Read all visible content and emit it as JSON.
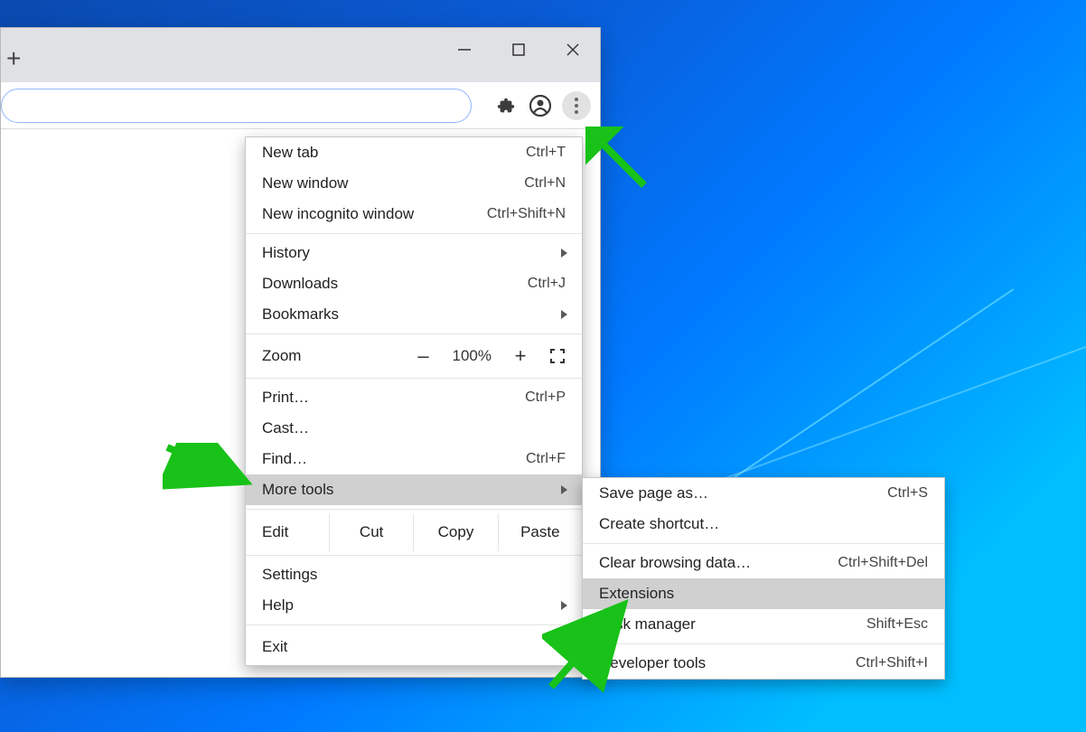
{
  "window": {
    "minimize_tooltip": "Minimize",
    "maximize_tooltip": "Maximize",
    "close_tooltip": "Close"
  },
  "toolbar": {
    "extensions_tooltip": "Extensions",
    "profile_tooltip": "You",
    "menu_tooltip": "Customize and control Google Chrome"
  },
  "menu": {
    "new_tab": {
      "label": "New tab",
      "shortcut": "Ctrl+T"
    },
    "new_window": {
      "label": "New window",
      "shortcut": "Ctrl+N"
    },
    "new_incognito": {
      "label": "New incognito window",
      "shortcut": "Ctrl+Shift+N"
    },
    "history": {
      "label": "History"
    },
    "downloads": {
      "label": "Downloads",
      "shortcut": "Ctrl+J"
    },
    "bookmarks": {
      "label": "Bookmarks"
    },
    "zoom": {
      "label": "Zoom",
      "value": "100%",
      "minus": "–",
      "plus": "+"
    },
    "print": {
      "label": "Print…",
      "shortcut": "Ctrl+P"
    },
    "cast": {
      "label": "Cast…"
    },
    "find": {
      "label": "Find…",
      "shortcut": "Ctrl+F"
    },
    "more_tools": {
      "label": "More tools"
    },
    "edit": {
      "label": "Edit",
      "cut": "Cut",
      "copy": "Copy",
      "paste": "Paste"
    },
    "settings": {
      "label": "Settings"
    },
    "help": {
      "label": "Help"
    },
    "exit": {
      "label": "Exit"
    }
  },
  "submenu": {
    "save_page": {
      "label": "Save page as…",
      "shortcut": "Ctrl+S"
    },
    "create_shortcut": {
      "label": "Create shortcut…"
    },
    "clear_data": {
      "label": "Clear browsing data…",
      "shortcut": "Ctrl+Shift+Del"
    },
    "extensions": {
      "label": "Extensions"
    },
    "task_manager": {
      "label": "Task manager",
      "shortcut": "Shift+Esc"
    },
    "dev_tools": {
      "label": "Developer tools",
      "shortcut": "Ctrl+Shift+I"
    }
  }
}
